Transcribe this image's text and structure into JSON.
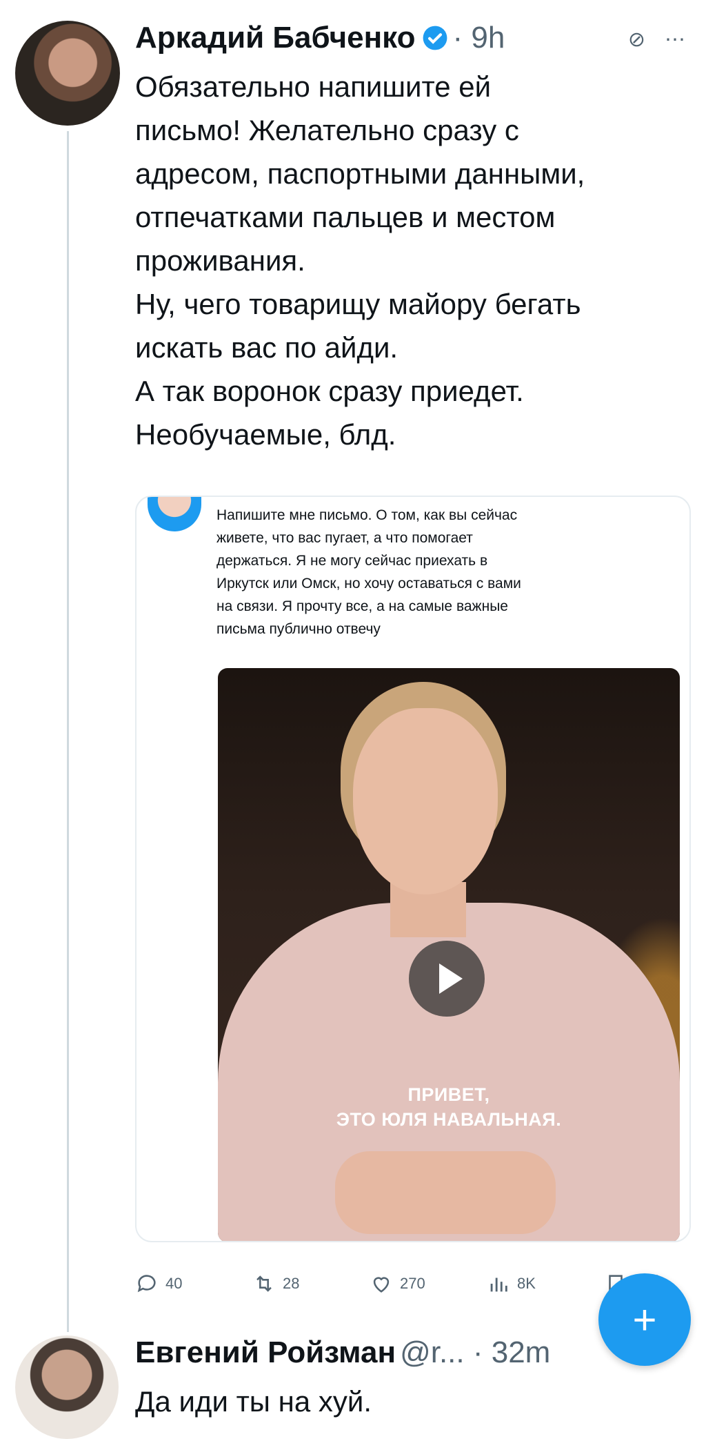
{
  "tweets": [
    {
      "author": "Аркадий Бабченко",
      "meta": "· 9h",
      "text": "Обязательно напишите ей\nписьмо! Желательно сразу с\nадресом, паспортными данными,\nотпечатками пальцев и местом\nпроживания.\nНу, чего товарищу майору бегать\nискать вас по айди.\nА так воронок сразу приедет.\nНеобучаемые, блд.",
      "quote": {
        "text": "Напишите мне письмо. О том, как вы сейчас\nживете, что вас пугает, а что помогает\nдержаться. Я не могу сейчас приехать в\nИркутск или Омск, но хочу оставаться с вами\nна связи. Я прочту все, а на самые важные\nписьма публично отвечу",
        "caption_line1": "ПРИВЕТ,",
        "caption_line2": "ЭТО ЮЛЯ НАВАЛЬНАЯ."
      },
      "actions": {
        "replies": "40",
        "retweets": "28",
        "likes": "270",
        "views": "8K"
      }
    },
    {
      "author": "Евгений Ройзман",
      "meta": "@r... · 32m",
      "text": "Да иди ты на хуй."
    }
  ],
  "icons": [
    "verified-icon",
    "reply-icon",
    "retweet-icon",
    "like-icon",
    "views-icon",
    "bookmark-icon",
    "share-icon",
    "more-icon",
    "play-icon",
    "compose-icon"
  ],
  "colors": {
    "accent": "#1d9bf0",
    "muted": "#536471",
    "text": "#0f1419"
  }
}
